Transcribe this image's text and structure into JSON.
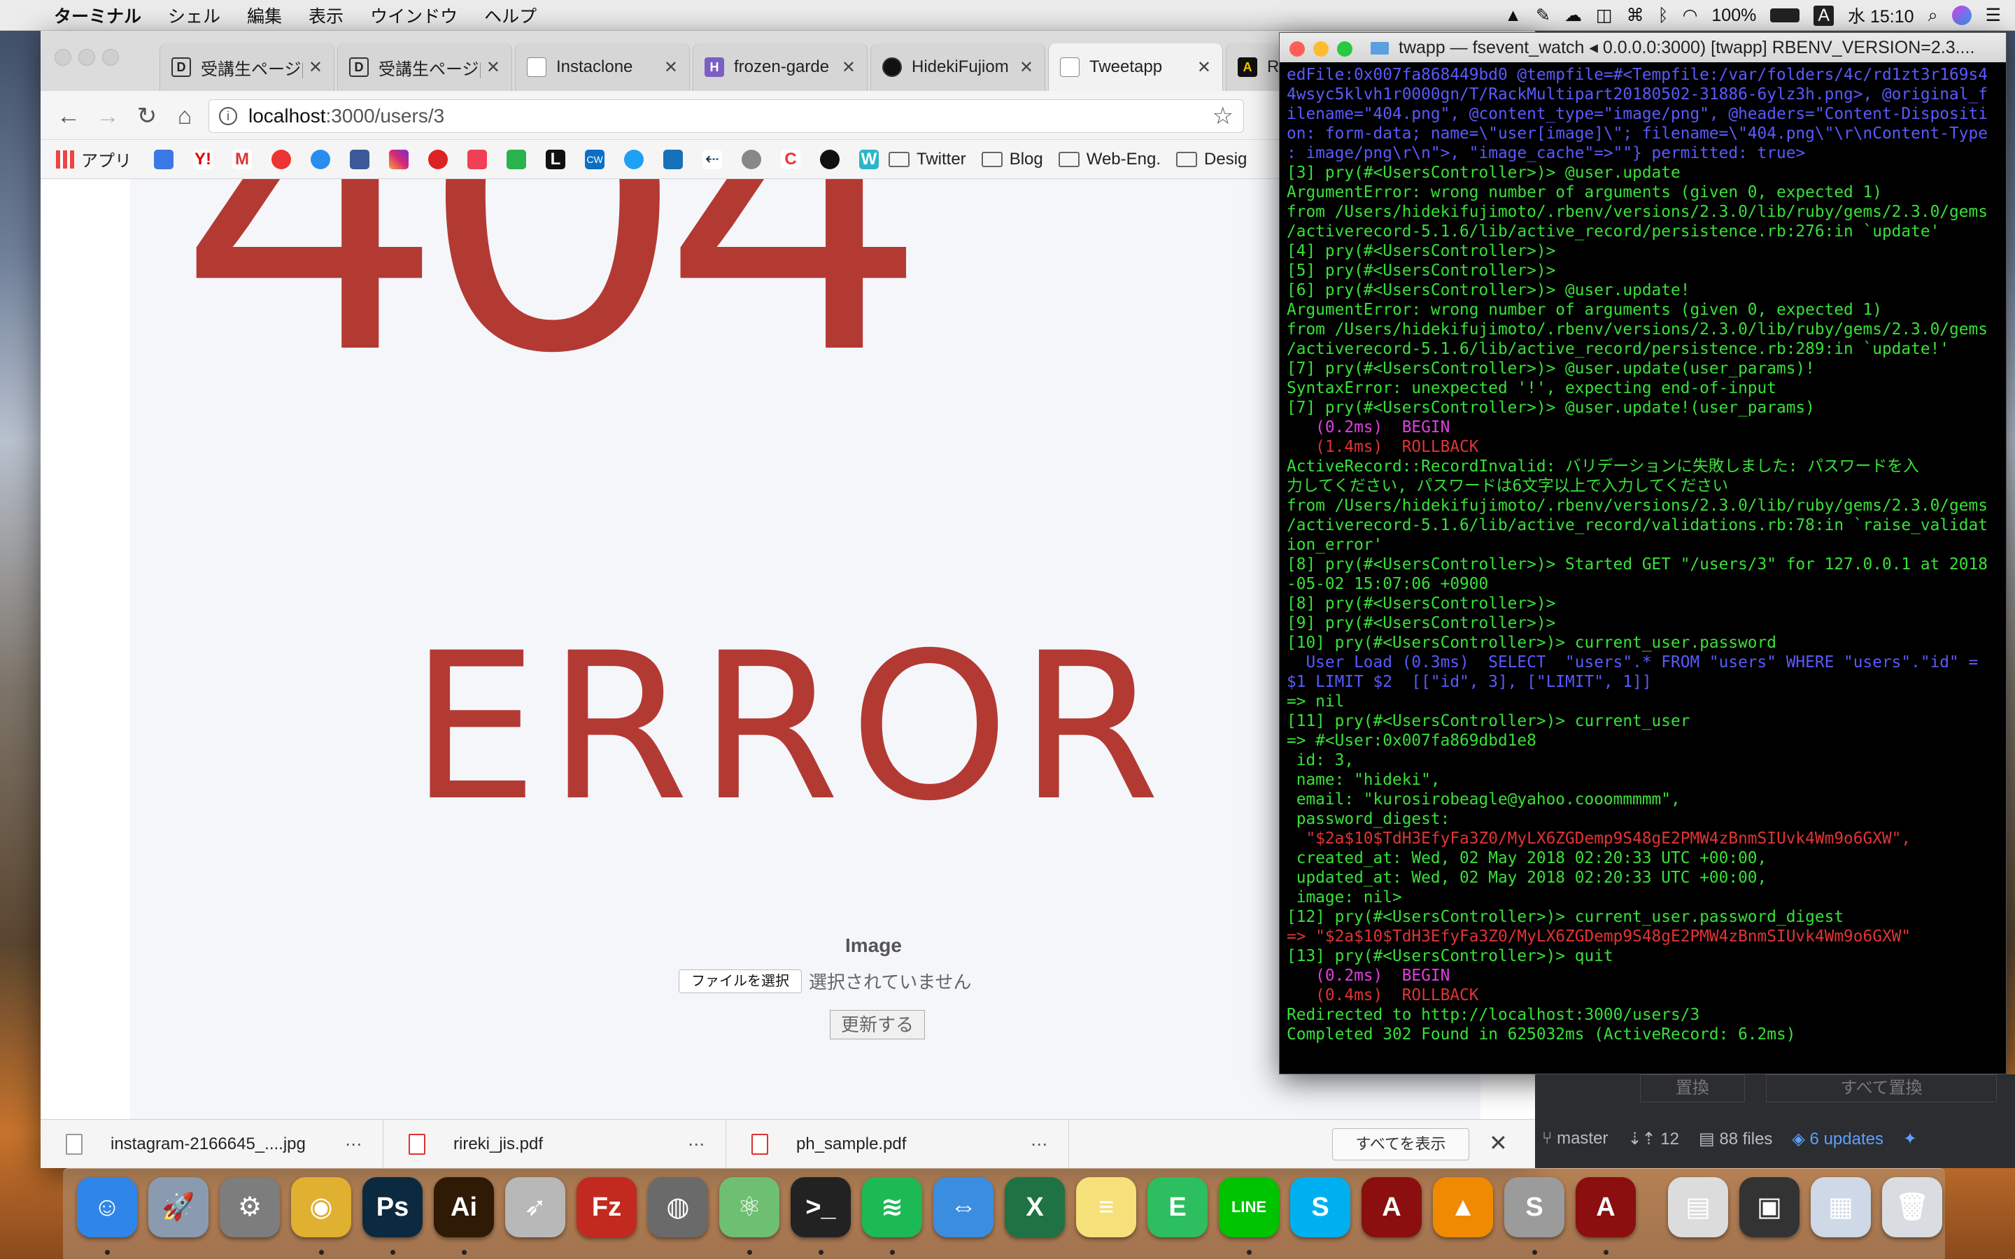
{
  "menubar": {
    "app": "ターミナル",
    "items": [
      "シェル",
      "編集",
      "表示",
      "ウインドウ",
      "ヘルプ"
    ],
    "battery": "100%",
    "input_mode": "A",
    "clock": "水 15:10"
  },
  "browser": {
    "tabs": [
      {
        "label": "受講生ページ|[",
        "favicon": "D"
      },
      {
        "label": "受講生ページ|[",
        "favicon": "D"
      },
      {
        "label": "Instaclone",
        "favicon": ""
      },
      {
        "label": "frozen-garde",
        "favicon": "H"
      },
      {
        "label": "HidekiFujiom",
        "favicon": ""
      },
      {
        "label": "Tweetapp",
        "favicon": ""
      },
      {
        "label": "R",
        "favicon": "A"
      }
    ],
    "url_host": "localhost",
    "url_rest": ":3000/users/3",
    "bookmarks": {
      "apps_label": "アプリ",
      "folders": [
        "Twitter",
        "Blog",
        "Web-Eng.",
        "Desig"
      ]
    },
    "page": {
      "error_code": "404",
      "error_word": "ERROR",
      "image_label": "Image",
      "file_button": "ファイルを選択",
      "file_status": "選択されていません",
      "submit_label": "更新する"
    },
    "downloads": {
      "items": [
        "instagram-2166645_....jpg",
        "rireki_jis.pdf",
        "ph_sample.pdf"
      ],
      "show_all": "すべてを表示",
      "menu_glyph": "⋯"
    }
  },
  "terminal": {
    "title": "twapp — fsevent_watch ◂ 0.0.0.0:3000) [twapp] RBENV_VERSION=2.3....",
    "lines": [
      {
        "t": "edFile:0x007fa868449bd0 @tempfile=#<Tempfile:/var/folders/4c/rd1zt3r169s4",
        "c": "c-blue"
      },
      {
        "t": "4wsyc5klvh1r0000gn/T/RackMultipart20180502-31886-6ylz3h.png>, @original_f",
        "c": "c-blue"
      },
      {
        "t": "ilename=\"404.png\", @content_type=\"image/png\", @headers=\"Content-Dispositi",
        "c": "c-blue"
      },
      {
        "t": "on: form-data; name=\\\"user[image]\\\"; filename=\\\"404.png\\\"\\r\\nContent-Type",
        "c": "c-blue"
      },
      {
        "t": ": image/png\\r\\n\">, \"image_cache\"=>\"\"} permitted: true>",
        "c": "c-blue"
      },
      {
        "t": "[3] pry(#<UsersController>)> @user.update",
        "c": ""
      },
      {
        "t": "ArgumentError: wrong number of arguments (given 0, expected 1)",
        "c": ""
      },
      {
        "t": "from /Users/hidekifujimoto/.rbenv/versions/2.3.0/lib/ruby/gems/2.3.0/gems",
        "c": ""
      },
      {
        "t": "/activerecord-5.1.6/lib/active_record/persistence.rb:276:in `update'",
        "c": ""
      },
      {
        "t": "[4] pry(#<UsersController>)>",
        "c": ""
      },
      {
        "t": "[5] pry(#<UsersController>)>",
        "c": ""
      },
      {
        "t": "[6] pry(#<UsersController>)> @user.update!",
        "c": ""
      },
      {
        "t": "ArgumentError: wrong number of arguments (given 0, expected 1)",
        "c": ""
      },
      {
        "t": "from /Users/hidekifujimoto/.rbenv/versions/2.3.0/lib/ruby/gems/2.3.0/gems",
        "c": ""
      },
      {
        "t": "/activerecord-5.1.6/lib/active_record/persistence.rb:289:in `update!'",
        "c": ""
      },
      {
        "t": "[7] pry(#<UsersController>)> @user.update(user_params)!",
        "c": ""
      },
      {
        "t": "SyntaxError: unexpected '!', expecting end-of-input",
        "c": ""
      },
      {
        "t": "[7] pry(#<UsersController>)> @user.update!(user_params)",
        "c": ""
      },
      {
        "t": "   (0.2ms)  BEGIN",
        "c": "c-mag"
      },
      {
        "t": "   (1.4ms)  ROLLBACK",
        "c": "c-red"
      },
      {
        "t": "ActiveRecord::RecordInvalid: バリデーションに失敗しました: パスワードを入",
        "c": ""
      },
      {
        "t": "力してください, パスワードは6文字以上で入力してください",
        "c": ""
      },
      {
        "t": "from /Users/hidekifujimoto/.rbenv/versions/2.3.0/lib/ruby/gems/2.3.0/gems",
        "c": ""
      },
      {
        "t": "/activerecord-5.1.6/lib/active_record/validations.rb:78:in `raise_validat",
        "c": ""
      },
      {
        "t": "ion_error'",
        "c": ""
      },
      {
        "t": "[8] pry(#<UsersController>)> Started GET \"/users/3\" for 127.0.0.1 at 2018",
        "c": ""
      },
      {
        "t": "-05-02 15:07:06 +0900",
        "c": ""
      },
      {
        "t": "[8] pry(#<UsersController>)>",
        "c": ""
      },
      {
        "t": "[9] pry(#<UsersController>)>",
        "c": ""
      },
      {
        "t": "[10] pry(#<UsersController>)> current_user.password",
        "c": ""
      },
      {
        "t": "  User Load (0.3ms)  SELECT  \"users\".* FROM \"users\" WHERE \"users\".\"id\" =",
        "c": "c-blue"
      },
      {
        "t": "$1 LIMIT $2  [[\"id\", 3], [\"LIMIT\", 1]]",
        "c": "c-blue"
      },
      {
        "t": "=> nil",
        "c": ""
      },
      {
        "t": "[11] pry(#<UsersController>)> current_user",
        "c": ""
      },
      {
        "t": "=> #<User:0x007fa869dbd1e8",
        "c": ""
      },
      {
        "t": " id: 3,",
        "c": ""
      },
      {
        "t": " name: \"hideki\",",
        "c": ""
      },
      {
        "t": " email: \"kurosirobeagle@yahoo.cooommmmm\",",
        "c": ""
      },
      {
        "t": " password_digest:",
        "c": ""
      },
      {
        "t": "  \"$2a$10$TdH3EfyFa3Z0/MyLX6ZGDemp9S48gE2PMW4zBnmSIUvk4Wm9o6GXW\",",
        "c": "c-red"
      },
      {
        "t": " created_at: Wed, 02 May 2018 02:20:33 UTC +00:00,",
        "c": ""
      },
      {
        "t": " updated_at: Wed, 02 May 2018 02:20:33 UTC +00:00,",
        "c": ""
      },
      {
        "t": " image: nil>",
        "c": ""
      },
      {
        "t": "[12] pry(#<UsersController>)> current_user.password_digest",
        "c": ""
      },
      {
        "t": "=> \"$2a$10$TdH3EfyFa3Z0/MyLX6ZGDemp9S48gE2PMW4zBnmSIUvk4Wm9o6GXW\"",
        "c": "c-red"
      },
      {
        "t": "[13] pry(#<UsersController>)> quit",
        "c": ""
      },
      {
        "t": "   (0.2ms)  BEGIN",
        "c": "c-mag"
      },
      {
        "t": "   (0.4ms)  ROLLBACK",
        "c": "c-red"
      },
      {
        "t": "Redirected to http://localhost:3000/users/3",
        "c": ""
      },
      {
        "t": "Completed 302 Found in 625032ms (ActiveRecord: 6.2ms)",
        "c": ""
      }
    ]
  },
  "github": {
    "buttons": [
      "置換",
      "すべて置換"
    ],
    "branch": "master",
    "arrows_count": "12",
    "files": "88 files",
    "updates": "6 updates"
  },
  "dock": {
    "apps": [
      {
        "name": "finder-icon",
        "color": "#2f86e8",
        "glyph": "☺"
      },
      {
        "name": "launchpad-icon",
        "color": "#8a9bb0",
        "glyph": "🚀"
      },
      {
        "name": "system-preferences-icon",
        "color": "#7d7d7d",
        "glyph": "⚙"
      },
      {
        "name": "chrome-icon",
        "color": "#e0b030",
        "glyph": "◉"
      },
      {
        "name": "photoshop-icon",
        "color": "#0b2a40",
        "glyph": "Ps"
      },
      {
        "name": "illustrator-icon",
        "color": "#2e1a05",
        "glyph": "Ai"
      },
      {
        "name": "transmit-icon",
        "color": "#b8b8b8",
        "glyph": "➶"
      },
      {
        "name": "filezilla-icon",
        "color": "#c32a1f",
        "glyph": "Fz"
      },
      {
        "name": "sequel-pro-icon",
        "color": "#6a6a6a",
        "glyph": "◍"
      },
      {
        "name": "atom-icon",
        "color": "#6fbf73",
        "glyph": "⚛"
      },
      {
        "name": "terminal-icon",
        "color": "#222222",
        "glyph": ">_"
      },
      {
        "name": "spotify-icon",
        "color": "#1db954",
        "glyph": "≋"
      },
      {
        "name": "teamviewer-icon",
        "color": "#3b8de0",
        "glyph": "⇔"
      },
      {
        "name": "excel-icon",
        "color": "#1f7244",
        "glyph": "X"
      },
      {
        "name": "notes-icon",
        "color": "#f6e07a",
        "glyph": "≡"
      },
      {
        "name": "evernote-icon",
        "color": "#2dbe60",
        "glyph": "E"
      },
      {
        "name": "line-icon",
        "color": "#00c300",
        "glyph": "LINE"
      },
      {
        "name": "skype-icon",
        "color": "#00aff0",
        "glyph": "S"
      },
      {
        "name": "acrobat-icon",
        "color": "#8b0f0f",
        "glyph": "A"
      },
      {
        "name": "vlc-icon",
        "color": "#f08a00",
        "glyph": "▲"
      },
      {
        "name": "sourcetree-icon",
        "color": "#9b9b9b",
        "glyph": "S"
      },
      {
        "name": "acrobat-reader-icon",
        "color": "#8b0f0f",
        "glyph": "A"
      },
      {
        "name": "document-stack-icon",
        "color": "#dcdcdc",
        "glyph": "▤"
      },
      {
        "name": "screenshot-stack-icon",
        "color": "#333333",
        "glyph": "▣"
      },
      {
        "name": "screenshot-stack-2-icon",
        "color": "#cfd8e6",
        "glyph": "▦"
      },
      {
        "name": "trash-icon",
        "color": "#d9dde2",
        "glyph": "🗑"
      }
    ]
  }
}
